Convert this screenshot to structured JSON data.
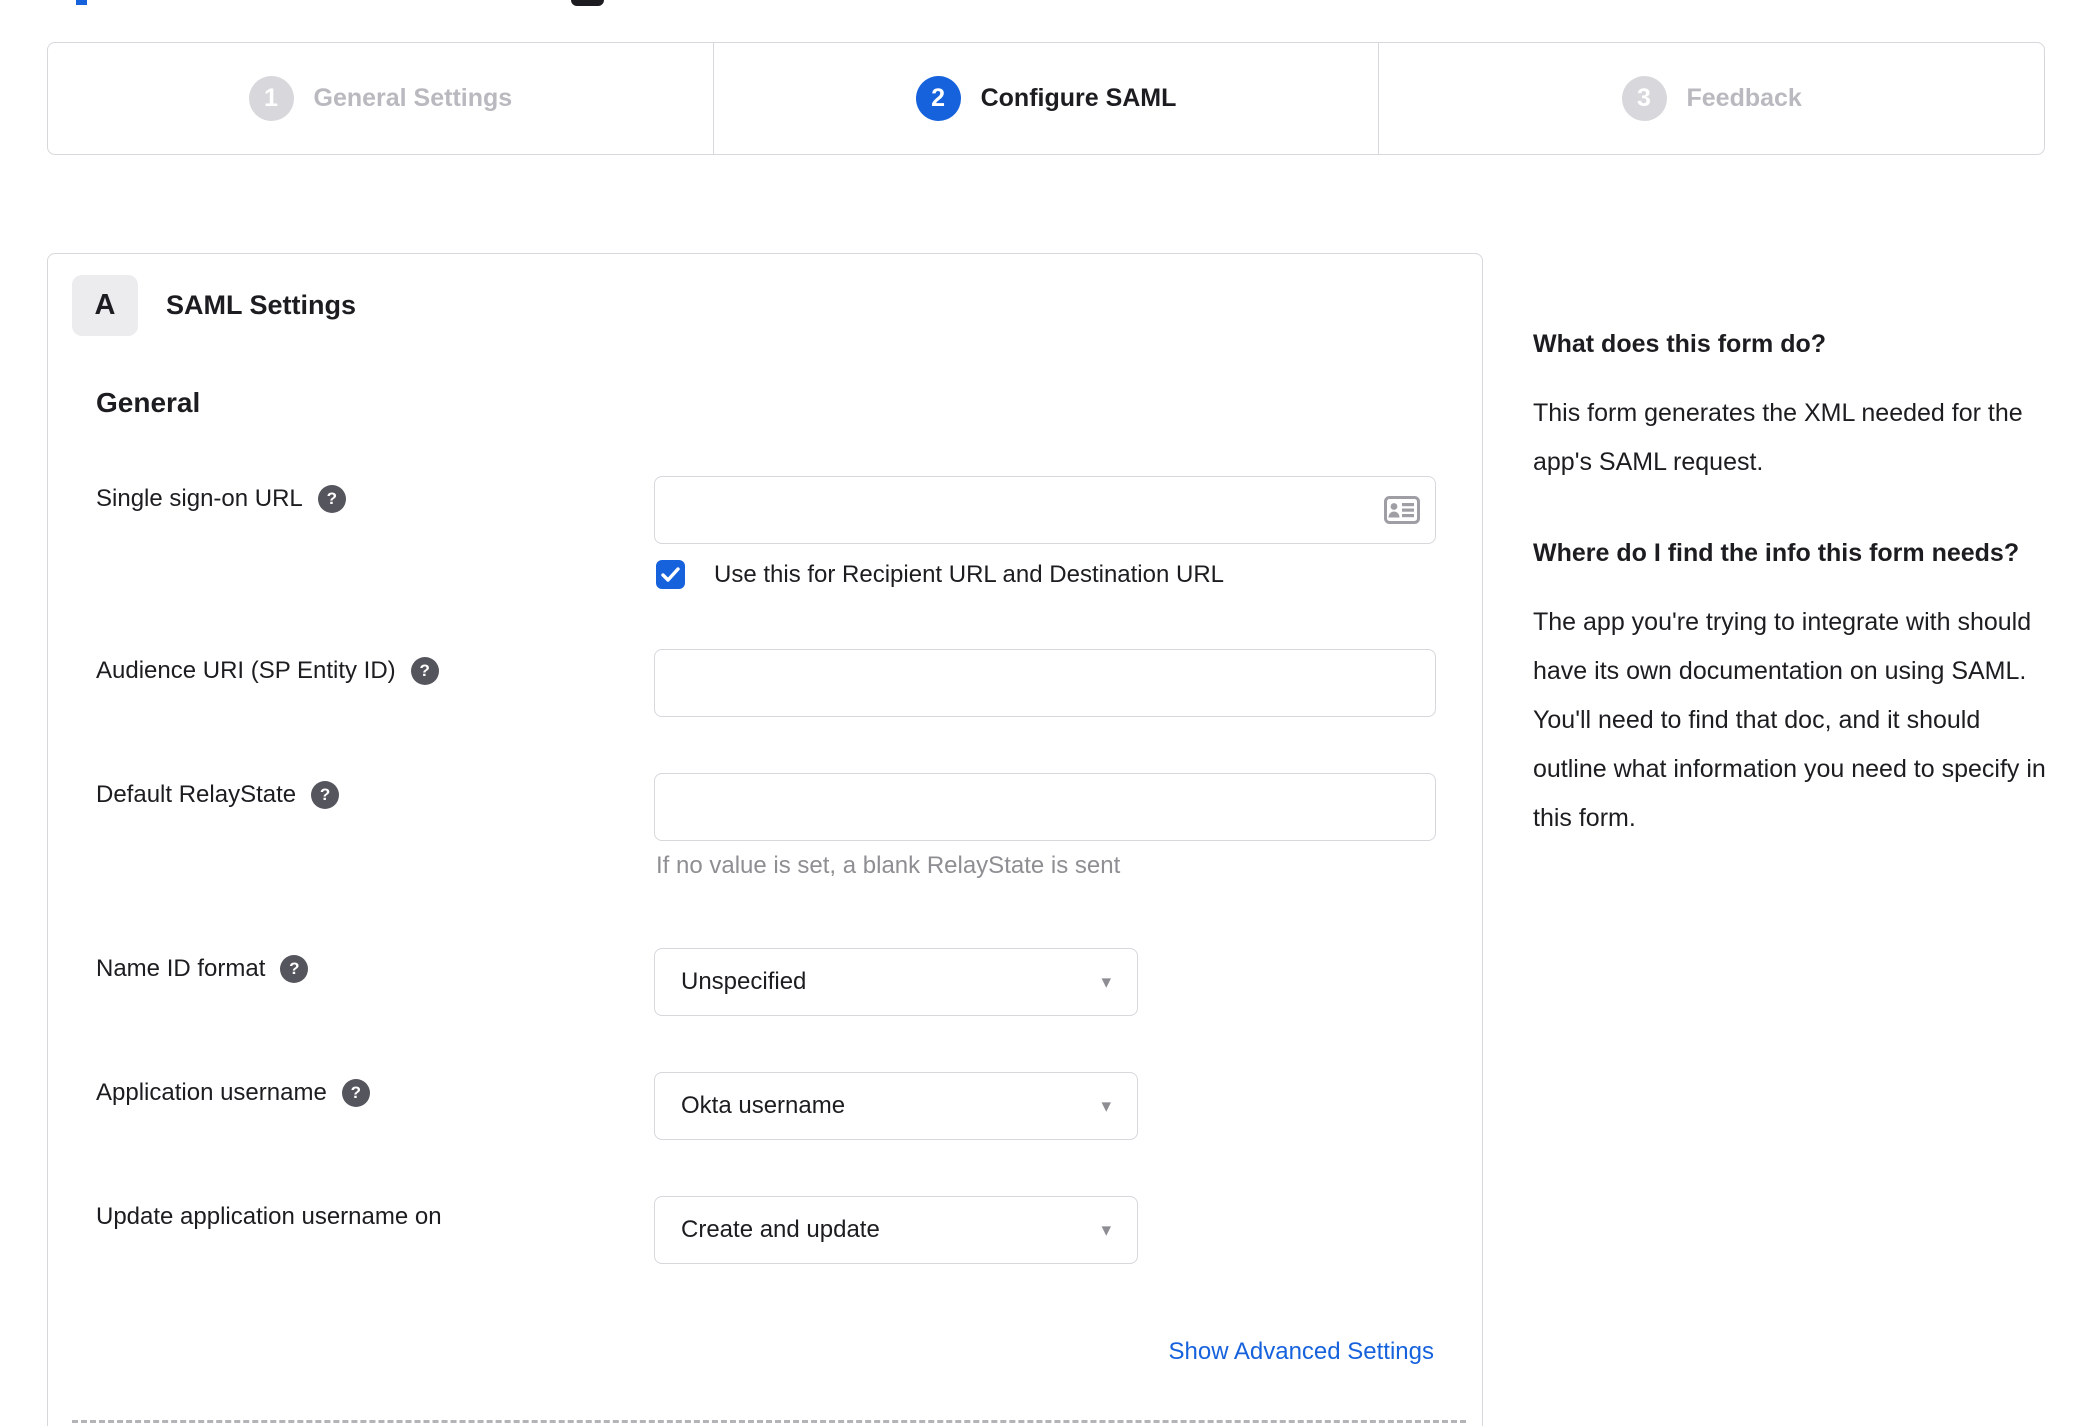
{
  "colors": {
    "accent": "#1662dd",
    "text": "#1d1d21",
    "muted_step": "#b9b9bf",
    "border": "#d7d7dc",
    "helper_text": "#8e8e93"
  },
  "stepper": {
    "steps": [
      {
        "number": "1",
        "label": "General Settings",
        "state": "inactive"
      },
      {
        "number": "2",
        "label": "Configure SAML",
        "state": "active"
      },
      {
        "number": "3",
        "label": "Feedback",
        "state": "inactive"
      }
    ]
  },
  "panel": {
    "badge": "A",
    "title": "SAML Settings",
    "section_heading": "General",
    "fields": {
      "sso": {
        "label": "Single sign-on URL",
        "value": "",
        "has_help": true
      },
      "sso_checkbox": {
        "label": "Use this for Recipient URL and Destination URL",
        "checked": true
      },
      "audience": {
        "label": "Audience URI (SP Entity ID)",
        "value": "",
        "has_help": true
      },
      "relay": {
        "label": "Default RelayState",
        "value": "",
        "has_help": true,
        "helper": "If no value is set, a blank RelayState is sent"
      },
      "name_id": {
        "label": "Name ID format",
        "value": "Unspecified",
        "has_help": true
      },
      "app_username": {
        "label": "Application username",
        "value": "Okta username",
        "has_help": true
      },
      "update_username": {
        "label": "Update application username on",
        "value": "Create and update",
        "has_help": false
      }
    },
    "advanced_link": "Show Advanced Settings"
  },
  "sidebar": {
    "q1": "What does this form do?",
    "a1": "This form generates the XML needed for the app's SAML request.",
    "q2": "Where do I find the info this form needs?",
    "a2": "The app you're trying to integrate with should have its own documentation on using SAML. You'll need to find that doc, and it should outline what information you need to specify in this form."
  },
  "icons": {
    "help": "?",
    "caret": "▾"
  }
}
